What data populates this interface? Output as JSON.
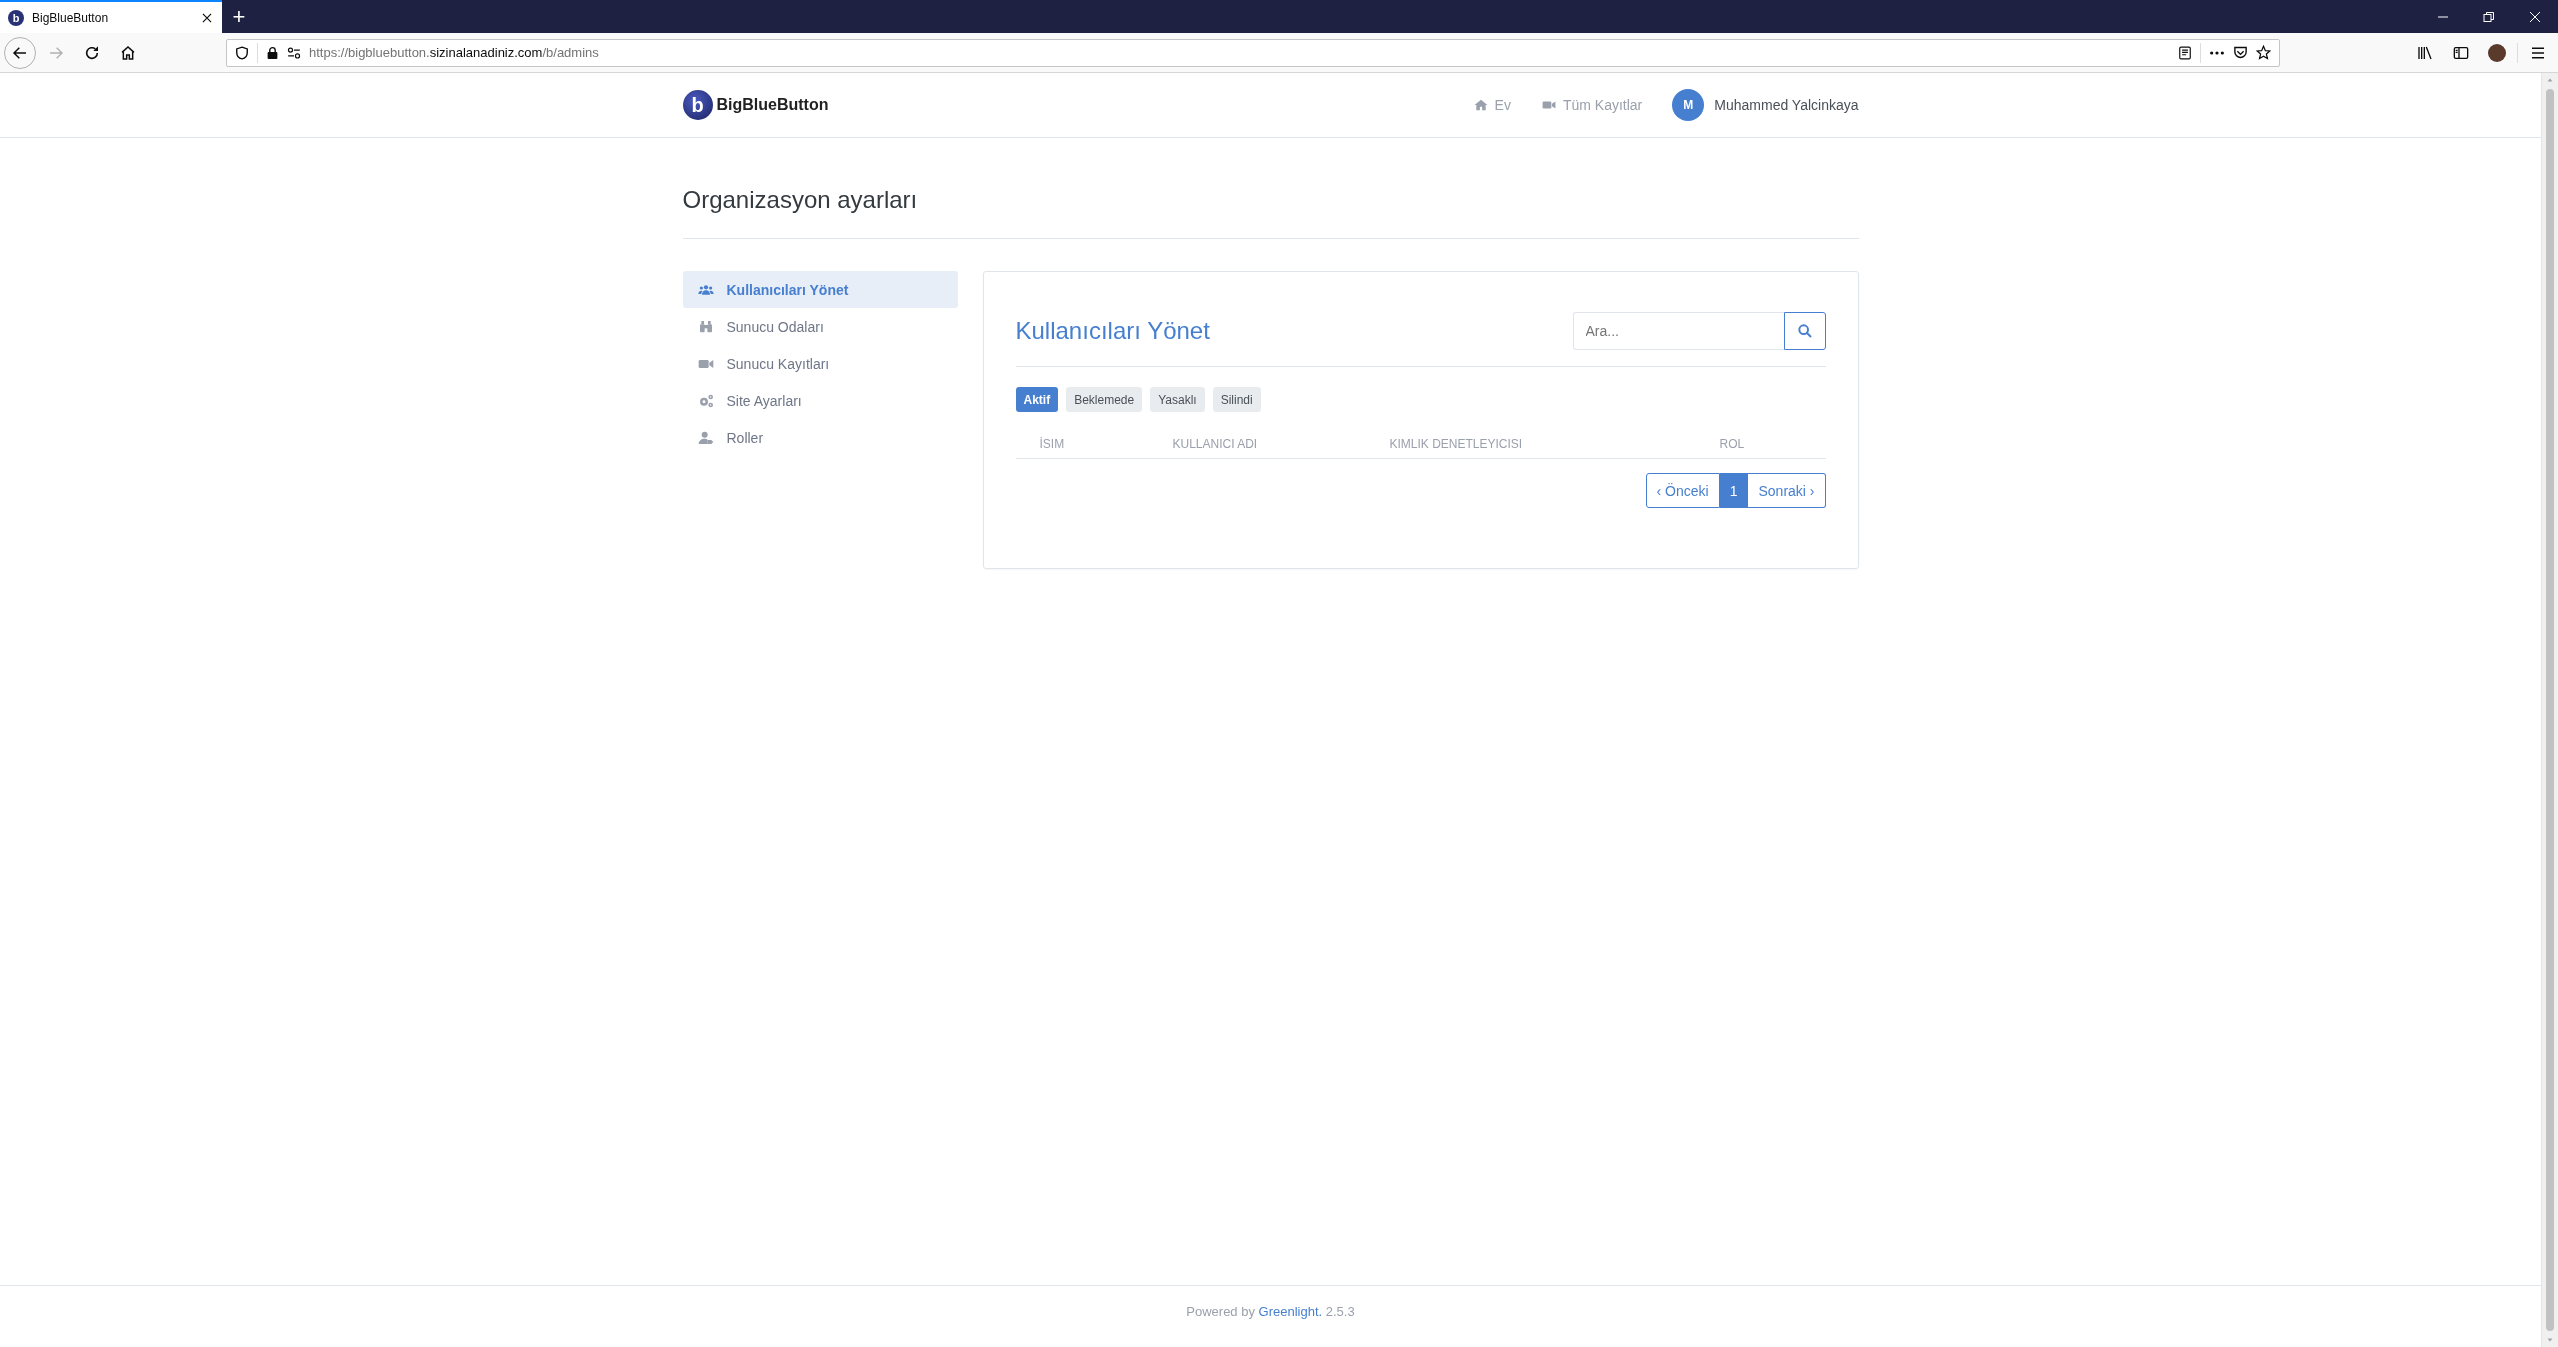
{
  "browser": {
    "tab": {
      "favicon": "b",
      "title": "BigBlueButton",
      "selected": true
    },
    "new_tab": "+",
    "url": {
      "prefix": "https://bigbluebutton.",
      "domain": "sizinalanadiniz.com",
      "path": "/b/admins"
    }
  },
  "header": {
    "logo": {
      "mark": "b",
      "name": "BigBlueButton"
    },
    "nav": [
      {
        "label": "Ev"
      },
      {
        "label": "Tüm Kayıtlar"
      }
    ],
    "user": {
      "initial": "M",
      "name": "Muhammed Yalcinkaya"
    }
  },
  "page_title": "Organizasyon ayarları",
  "sidebar": {
    "items": [
      {
        "label": "Kullanıcıları Yönet",
        "selected": true
      },
      {
        "label": "Sunucu Odaları",
        "selected": false
      },
      {
        "label": "Sunucu Kayıtları",
        "selected": false
      },
      {
        "label": "Site Ayarları",
        "selected": false
      },
      {
        "label": "Roller",
        "selected": false
      }
    ]
  },
  "panel": {
    "title": "Kullanıcıları Yönet",
    "search": {
      "placeholder": "Ara..."
    },
    "filters": [
      {
        "label": "Aktif",
        "selected": true
      },
      {
        "label": "Beklemede",
        "selected": false
      },
      {
        "label": "Yasaklı",
        "selected": false
      },
      {
        "label": "Silindi",
        "selected": false
      }
    ],
    "table": {
      "columns": [
        "İSIM",
        "KULLANICI ADI",
        "KIMLIK DENETLEYICISI",
        "ROL"
      ]
    },
    "pagination": {
      "previous": "‹ Önceki",
      "pages": [
        {
          "label": "1",
          "selected": true
        }
      ],
      "next": "Sonraki ›"
    }
  },
  "footer": {
    "prefix": "Powered by",
    "link": "Greenlight.",
    "version": "2.5.3"
  }
}
